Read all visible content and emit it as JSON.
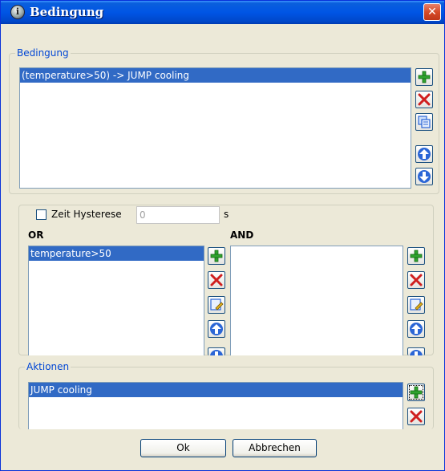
{
  "window": {
    "title": "Bedingung",
    "icon": "info-icon",
    "close_glyph": "✕"
  },
  "bedingung_group": {
    "legend": "Bedingung",
    "items": [
      {
        "label": "(temperature>50) -> JUMP cooling",
        "selected": true
      }
    ]
  },
  "zeit_hysterese": {
    "label": "Zeit Hysterese",
    "checked": false,
    "value": "0",
    "unit": "s"
  },
  "or_list": {
    "header": "OR",
    "items": [
      {
        "label": "temperature>50",
        "selected": true
      }
    ]
  },
  "and_list": {
    "header": "AND",
    "items": []
  },
  "aktionen_group": {
    "legend": "Aktionen",
    "items": [
      {
        "label": "JUMP cooling",
        "selected": true
      }
    ]
  },
  "buttons": {
    "ok": "Ok",
    "cancel": "Abbrechen"
  },
  "colors": {
    "selection": "#316ac5",
    "legend_text": "#0046d5",
    "add_icon": "#2fa32f",
    "delete_icon": "#d01f1f",
    "arrow_icon": "#2b66d6"
  }
}
